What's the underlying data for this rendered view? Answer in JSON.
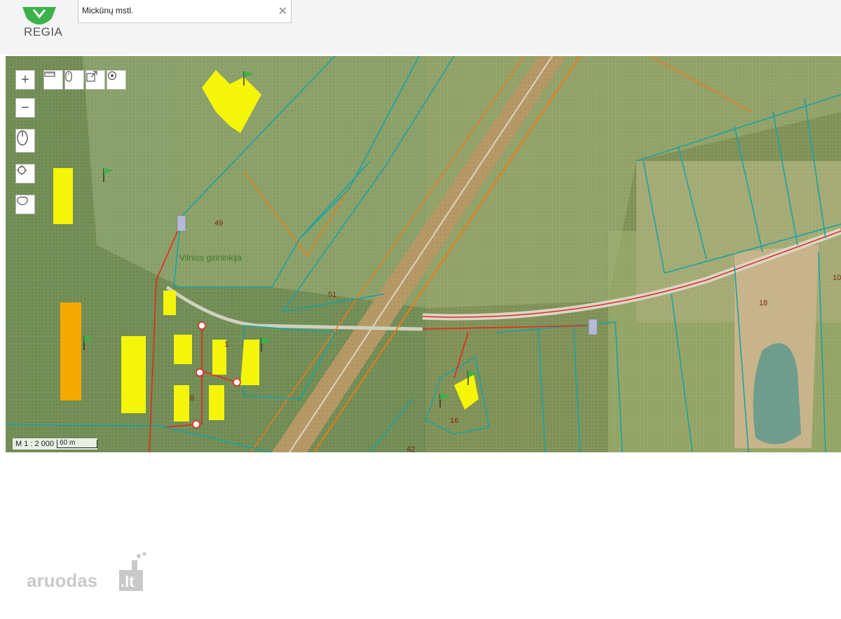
{
  "header": {
    "logo_text": "REGIA",
    "search_value": "Mickūnų mstl.",
    "clear_icon": "close-icon"
  },
  "map": {
    "zoom_in_label": "+",
    "zoom_out_label": "−",
    "scale_text": "M 1 : 2 000",
    "scale_bar_text": "60 m",
    "labels": {
      "l49": "49",
      "school": "Vilnios girininkija",
      "l51": "51",
      "l16": "16",
      "l18": "18",
      "l10": "10",
      "l1": "1",
      "l42": "42",
      "l8": "8"
    }
  },
  "colors": {
    "parcel_line": "#1aa3a3",
    "power_line": "#e8261c",
    "road_line": "#f07a16",
    "building": "#f5f50a",
    "building_orange": "#f5a800",
    "brand_green": "#3cb24a"
  },
  "watermark": {
    "text_main": "aruodas",
    "text_tld": ".lt"
  }
}
